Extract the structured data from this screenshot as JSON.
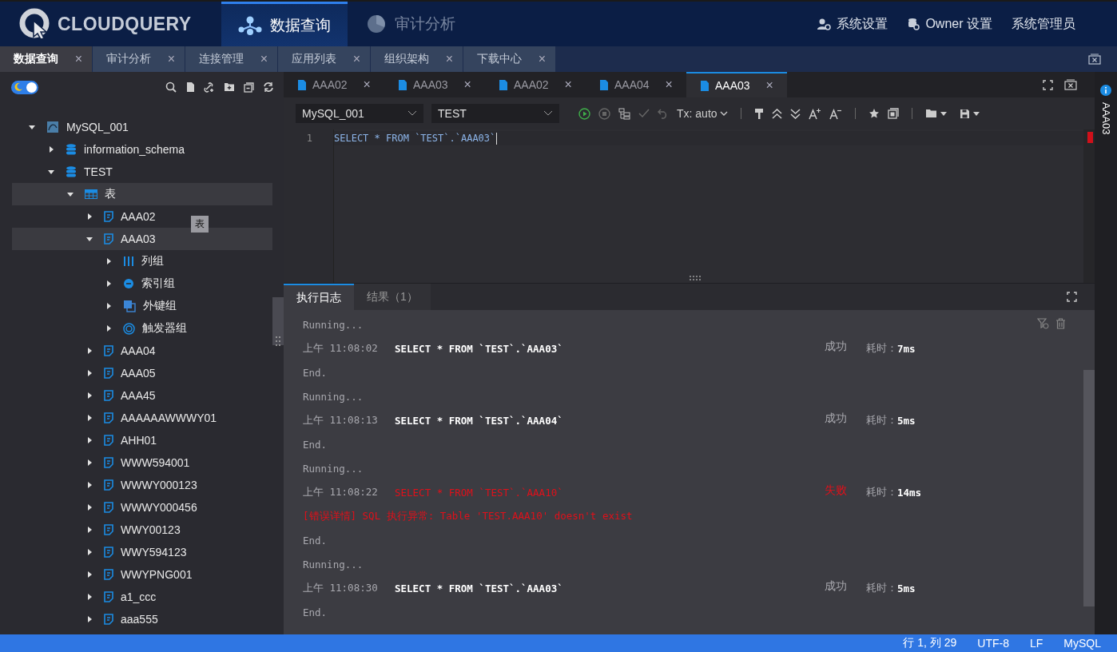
{
  "header": {
    "logo_text": "CLOUDQUERY",
    "nav": [
      {
        "label": "数据查询",
        "selected": true
      },
      {
        "label": "审计分析",
        "selected": false
      }
    ],
    "actions": [
      {
        "label": "系统设置"
      },
      {
        "label": "Owner 设置"
      },
      {
        "label": "系统管理员"
      }
    ]
  },
  "page_tabs": [
    {
      "label": "数据查询",
      "close": "×",
      "selected": true
    },
    {
      "label": "审计分析",
      "close": "×",
      "selected": false
    },
    {
      "label": "连接管理",
      "close": "×",
      "selected": false
    },
    {
      "label": "应用列表",
      "close": "×",
      "selected": false
    },
    {
      "label": "组织架构",
      "close": "×",
      "selected": false
    },
    {
      "label": "下载中心",
      "close": "×",
      "selected": false
    }
  ],
  "sidebar": {
    "dark_mode": true,
    "tree": [
      {
        "label": "MySQL_001",
        "kind": "connection",
        "expanded": true,
        "selected": false,
        "children": [
          {
            "label": "information_schema",
            "kind": "database",
            "expanded": false,
            "selected": false
          },
          {
            "label": "TEST",
            "kind": "database",
            "expanded": true,
            "selected": false,
            "children": [
              {
                "label": "表",
                "kind": "table-group",
                "expanded": true,
                "selected": true,
                "children": [
                  {
                    "label": "AAA02",
                    "kind": "table",
                    "expanded": false,
                    "selected": false
                  },
                  {
                    "label": "AAA03",
                    "kind": "table",
                    "expanded": true,
                    "selected": true,
                    "children": [
                      {
                        "label": "列组",
                        "kind": "columns",
                        "expanded": false,
                        "selected": false
                      },
                      {
                        "label": "索引组",
                        "kind": "index",
                        "expanded": false,
                        "selected": false
                      },
                      {
                        "label": "外键组",
                        "kind": "foreign-key",
                        "expanded": false,
                        "selected": false
                      },
                      {
                        "label": "触发器组",
                        "kind": "trigger",
                        "expanded": false,
                        "selected": false
                      }
                    ]
                  },
                  {
                    "label": "AAA04",
                    "kind": "table",
                    "expanded": false,
                    "selected": false
                  },
                  {
                    "label": "AAA05",
                    "kind": "table",
                    "expanded": false,
                    "selected": false
                  },
                  {
                    "label": "AAA45",
                    "kind": "table",
                    "expanded": false,
                    "selected": false
                  },
                  {
                    "label": "AAAAAAWWWY01",
                    "kind": "table",
                    "expanded": false,
                    "selected": false
                  },
                  {
                    "label": "AHH01",
                    "kind": "table",
                    "expanded": false,
                    "selected": false
                  },
                  {
                    "label": "WWW594001",
                    "kind": "table",
                    "expanded": false,
                    "selected": false
                  },
                  {
                    "label": "WWWY000123",
                    "kind": "table",
                    "expanded": false,
                    "selected": false
                  },
                  {
                    "label": "WWWY000456",
                    "kind": "table",
                    "expanded": false,
                    "selected": false
                  },
                  {
                    "label": "WWY00123",
                    "kind": "table",
                    "expanded": false,
                    "selected": false
                  },
                  {
                    "label": "WWY594123",
                    "kind": "table",
                    "expanded": false,
                    "selected": false
                  },
                  {
                    "label": "WWYPNG001",
                    "kind": "table",
                    "expanded": false,
                    "selected": false
                  },
                  {
                    "label": "a1_ccc",
                    "kind": "table",
                    "expanded": false,
                    "selected": false
                  },
                  {
                    "label": "aaa555",
                    "kind": "table",
                    "expanded": false,
                    "selected": false
                  }
                ]
              }
            ]
          }
        ]
      }
    ],
    "tooltip": "表"
  },
  "editor_tabs": [
    {
      "label": "AAA02",
      "close": "×",
      "selected": false
    },
    {
      "label": "AAA03",
      "close": "×",
      "selected": false
    },
    {
      "label": "AAA02",
      "close": "×",
      "selected": false
    },
    {
      "label": "AAA04",
      "close": "×",
      "selected": false
    },
    {
      "label": "AAA03",
      "close": "×",
      "selected": true
    }
  ],
  "toolbar": {
    "connection": "MySQL_001",
    "database": "TEST",
    "tx_mode": "Tx: auto"
  },
  "code": {
    "lines": [
      {
        "number": "1",
        "text": "SELECT * FROM `TEST`.`AAA03`"
      }
    ]
  },
  "result_tabs": [
    {
      "label": "执行日志",
      "selected": true
    },
    {
      "label": "结果（1）",
      "selected": false
    }
  ],
  "log": [
    {
      "kind": "running",
      "text": "Running..."
    },
    {
      "kind": "query",
      "period": "上午",
      "time": "11:08:02",
      "sql": "SELECT * FROM `TEST`.`AAA03`",
      "status": "成功",
      "failed": false,
      "duration_label": "耗时：",
      "duration": "7ms"
    },
    {
      "kind": "end",
      "text": "End."
    },
    {
      "kind": "running",
      "text": "Running..."
    },
    {
      "kind": "query",
      "period": "上午",
      "time": "11:08:13",
      "sql": "SELECT * FROM `TEST`.`AAA04`",
      "status": "成功",
      "failed": false,
      "duration_label": "耗时：",
      "duration": "5ms"
    },
    {
      "kind": "end",
      "text": "End."
    },
    {
      "kind": "running",
      "text": "Running..."
    },
    {
      "kind": "query",
      "period": "上午",
      "time": "11:08:22",
      "sql": "SELECT * FROM `TEST`.`AAA10`",
      "status": "失败",
      "failed": true,
      "duration_label": "耗时：",
      "duration": "14ms"
    },
    {
      "kind": "error",
      "text": "[错误详情] SQL 执行异常: Table 'TEST.AAA10' doesn't exist"
    },
    {
      "kind": "end",
      "text": "End."
    },
    {
      "kind": "running",
      "text": "Running..."
    },
    {
      "kind": "query",
      "period": "上午",
      "time": "11:08:30",
      "sql": "SELECT * FROM `TEST`.`AAA03`",
      "status": "成功",
      "failed": false,
      "duration_label": "耗时：",
      "duration": "5ms"
    },
    {
      "kind": "end",
      "text": "End."
    }
  ],
  "side_panel": {
    "label": "AAA03"
  },
  "status_bar": [
    "行 1, 列 29",
    "UTF-8",
    "LF",
    "MySQL"
  ]
}
